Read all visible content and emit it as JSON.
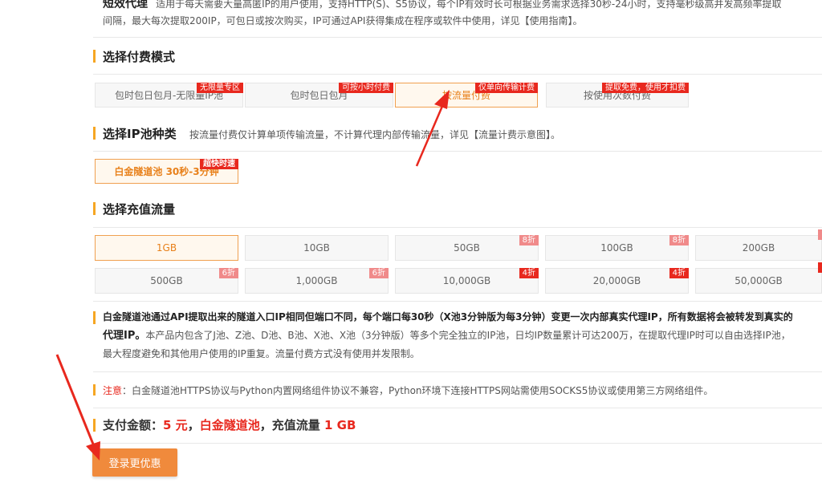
{
  "top": {
    "product_name": "短效代理",
    "line1": "适用于每天需要大量高匿IP的用户使用，支持HTTP(S)、S5协议，每个IP有效时长可根据业务需求选择30秒-24小时，支持毫秒级高并发高频率提取",
    "line2": "间隔，最大每次提取200IP，可包日或按次购买，IP可通过API获得集成在程序或软件中使用，详见【使用指南】。"
  },
  "payment": {
    "title": "选择付费模式",
    "options": [
      {
        "label": "包时包日包月-无限量IP池",
        "badge": "无限量专区",
        "selected": false
      },
      {
        "label": "包时包日包月",
        "badge": "可按小时付费",
        "selected": false
      },
      {
        "label": "按流量付费",
        "badge": "仅单向传输计费",
        "selected": true
      },
      {
        "label": "按使用次数付费",
        "badge": "提取免费，使用才扣费",
        "selected": false
      }
    ]
  },
  "pool": {
    "title": "选择IP池种类",
    "desc": "按流量付费仅计算单项传输流量，不计算代理内部传输流量，详见【流量计费示意图】。",
    "option_label": "白金隧道池 30秒-3分钟",
    "option_badge": "超快时速"
  },
  "traffic": {
    "title": "选择充值流量",
    "row1": [
      {
        "label": "1GB",
        "badge": "",
        "selected": true
      },
      {
        "label": "10GB",
        "badge": ""
      },
      {
        "label": "50GB",
        "badge": "8折"
      },
      {
        "label": "100GB",
        "badge": "8折"
      },
      {
        "label": "200GB",
        "badge": ""
      }
    ],
    "row2": [
      {
        "label": "500GB",
        "badge": "6折"
      },
      {
        "label": "1,000GB",
        "badge": "6折"
      },
      {
        "label": "10,000GB",
        "badge": "4折"
      },
      {
        "label": "20,000GB",
        "badge": "4折"
      },
      {
        "label": "50,000GB",
        "badge": ""
      }
    ]
  },
  "info": {
    "p1_bold": "白金隧道池通过API提取出来的隧道入口IP相同但端口不同，",
    "p1_red": "每个端口每30秒（X池3分钟版为每3分钟）变更一次内部真实代理IP",
    "p1_bold2": "，所有数据将会被转发到真实的",
    "p2_bold": "代理IP。",
    "p2_rest": "本产品内包含了J池、Z池、D池、B池、X池、X池（3分钟版）等多个完全独立的IP池，日均IP数量累计可达200万，在提取代理IP时可以自由选择IP池，",
    "p3": "最大程度避免和其他用户使用的IP重复。流量付费方式没有使用并发限制。"
  },
  "notice": {
    "label": "注意",
    "text": "：白金隧道池HTTPS协议与Python内置网络组件协议不兼容，Python环境下连接HTTPS网站需使用SOCKS5协议或使用第三方网络组件。"
  },
  "total": {
    "prefix": "支付金额：",
    "amount": "5 元",
    "sep1": "，",
    "pool": "白金隧道池",
    "sep2": "，充值流量",
    "traffic": "1 GB"
  },
  "login_button": "登录更优惠",
  "colors": {
    "accent": "#f08a3c",
    "badge_red": "#e8281e",
    "bar": "#f6a623"
  }
}
